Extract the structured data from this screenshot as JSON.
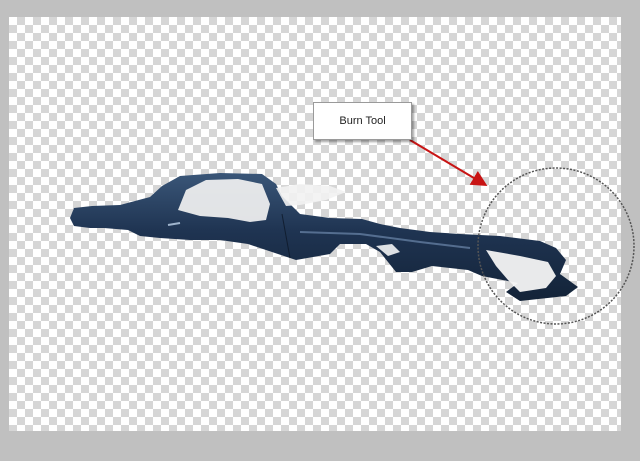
{
  "callout": {
    "label": "Burn Tool"
  },
  "colors": {
    "car_body": "#1f3452",
    "arrow": "#c81414",
    "brush_circle": "#555555"
  },
  "icons": {
    "brush_cursor": "circle-brush-icon",
    "arrow": "arrow-pointer-icon"
  }
}
